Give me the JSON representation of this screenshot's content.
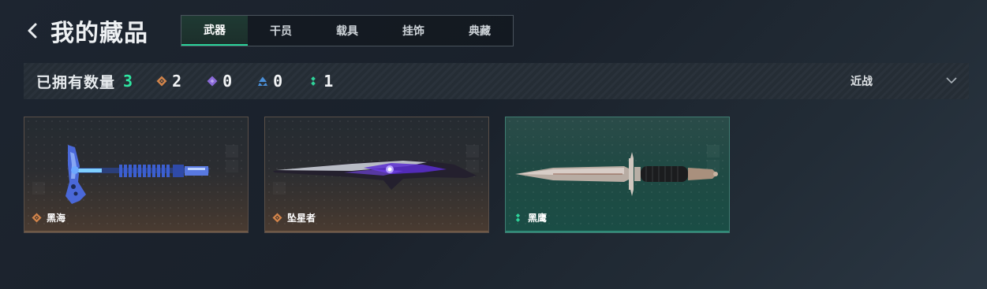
{
  "header": {
    "back_icon": "chevron-left-icon",
    "title": "我的藏品"
  },
  "tabs": [
    {
      "label": "武器",
      "active": true
    },
    {
      "label": "干员",
      "active": false
    },
    {
      "label": "载具",
      "active": false
    },
    {
      "label": "挂饰",
      "active": false
    },
    {
      "label": "典藏",
      "active": false
    }
  ],
  "stats": {
    "owned_label": "已拥有数量",
    "owned_count": "3",
    "rarities": [
      {
        "icon": "orange-diamond-icon",
        "color": "#d2844a",
        "count": "2"
      },
      {
        "icon": "purple-diamond-icon",
        "color": "#8a6ad8",
        "count": "0"
      },
      {
        "icon": "blue-triangle-icon",
        "color": "#4a8fd8",
        "count": "0"
      },
      {
        "icon": "green-dots-icon",
        "color": "#2fd39a",
        "count": "1"
      }
    ]
  },
  "filter": {
    "label": "近战",
    "icon": "chevron-down-icon"
  },
  "items": [
    {
      "name": "黑海",
      "rarity": "orange",
      "rarity_icon": "orange-diamond-icon",
      "art": "tactical-axe"
    },
    {
      "name": "坠星者",
      "rarity": "orange",
      "rarity_icon": "orange-diamond-icon",
      "art": "purple-blade"
    },
    {
      "name": "黑鹰",
      "rarity": "green",
      "rarity_icon": "green-dots-icon",
      "art": "combat-dagger"
    }
  ],
  "colors": {
    "accent": "#2fe6a2",
    "orange": "#d2844a",
    "teal_card": "#1f4a44"
  }
}
